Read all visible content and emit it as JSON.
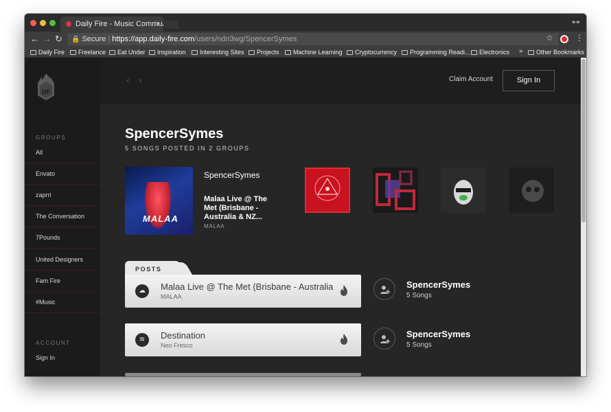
{
  "browser": {
    "tab_title": "Daily Fire - Music Communiti",
    "tab_close": "×",
    "url_secure_label": "Secure",
    "url_host": "https://app.daily-fire.com",
    "url_path": "/users/ndn3wg/SpencerSymes",
    "nav": {
      "back": "←",
      "forward": "→",
      "reload": "↻"
    },
    "star": "☆",
    "menu": "⋮",
    "incognito": "👓",
    "bookmarks": [
      "Daily Fire",
      "Freelance",
      "Eat Under",
      "Inspiration",
      "Interesting Sites",
      "Projects",
      "Machine Learning",
      "Cryptocurrency",
      "Programming Readi...",
      "Electronics"
    ],
    "bookmarks_more": "»",
    "other_bookmarks": "Other Bookmarks"
  },
  "sidebar": {
    "groups_heading": "GROUPS",
    "groups": [
      "All",
      "Envato",
      "zaprri",
      "The Conversation",
      "7Pounds",
      "United Designers",
      "Fam Fire",
      "#Music"
    ],
    "account_heading": "ACCOUNT",
    "account_items": [
      "Sign In"
    ]
  },
  "header": {
    "back_chevron": "‹",
    "forward_chevron": "›",
    "claim_account": "Claim Account",
    "sign_in": "Sign In"
  },
  "profile": {
    "username": "SpencerSymes",
    "subtitle": "5 SONGS POSTED IN 2 GROUPS"
  },
  "featured": {
    "art_text": "MALAA",
    "user": "SpencerSymes",
    "title": "Malaa Live @ The Met (Brisbane - Australia & NZ...",
    "artist": "MALAA"
  },
  "posts_tab": "POSTS",
  "posts": [
    {
      "title": "Malaa Live @ The Met (Brisbane - Australia & NZ",
      "artist": "MALAA",
      "service": "soundcloud-icon",
      "service_glyph": "☁"
    },
    {
      "title": "Destination",
      "artist": "Neo Fresco",
      "service": "spotify-icon",
      "service_glyph": "≋"
    }
  ],
  "user_cards": [
    {
      "name": "SpencerSymes",
      "songs": "5 Songs"
    },
    {
      "name": "SpencerSymes",
      "songs": "5 Songs"
    }
  ],
  "colors": {
    "accent": "#e3324b",
    "sidebar_divider": "#3a1d22",
    "background": "#262626"
  }
}
